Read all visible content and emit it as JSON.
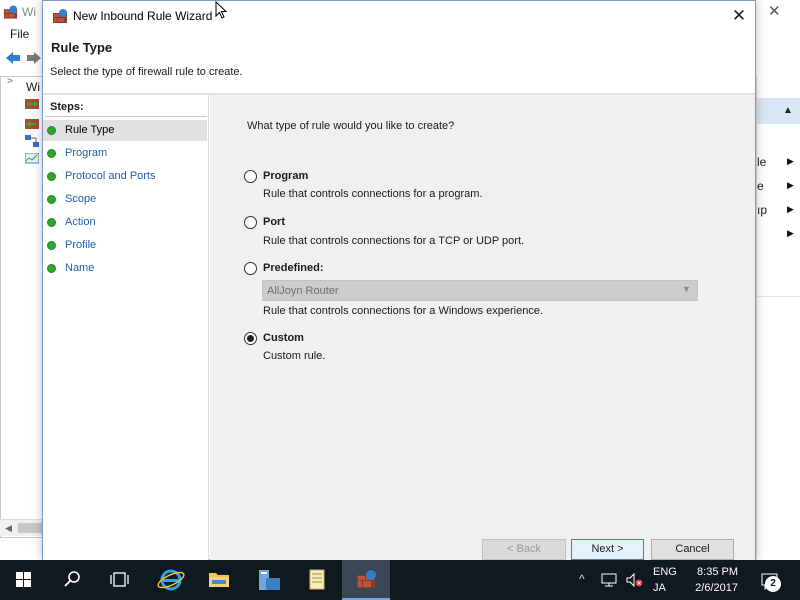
{
  "background_window": {
    "title": "Wi",
    "menu": {
      "file": "File"
    },
    "tree_root_label": "Wi",
    "actions_rows": [
      {
        "text": "le"
      },
      {
        "text": "e"
      },
      {
        "text": "ıp"
      },
      {
        "text": ""
      }
    ]
  },
  "wizard": {
    "title": "New Inbound Rule Wizard",
    "heading": "Rule Type",
    "subheading": "Select the type of firewall rule to create.",
    "steps_title": "Steps:",
    "steps": [
      {
        "label": "Rule Type",
        "current": true
      },
      {
        "label": "Program"
      },
      {
        "label": "Protocol and Ports"
      },
      {
        "label": "Scope"
      },
      {
        "label": "Action"
      },
      {
        "label": "Profile"
      },
      {
        "label": "Name"
      }
    ],
    "question": "What type of rule would you like to create?",
    "options": [
      {
        "title": "Program",
        "description": "Rule that controls connections for a program.",
        "selected": false
      },
      {
        "title": "Port",
        "description": "Rule that controls connections for a TCP or UDP port.",
        "selected": false
      },
      {
        "title": "Predefined:",
        "description": "Rule that controls connections for a Windows experience.",
        "selected": false,
        "dropdown_value": "AllJoyn Router",
        "dropdown_disabled": true
      },
      {
        "title": "Custom",
        "description": "Custom rule.",
        "selected": true
      }
    ],
    "buttons": {
      "back": "< Back",
      "next": "Next >",
      "cancel": "Cancel"
    }
  },
  "taskbar": {
    "language_line1": "ENG",
    "language_line2": "JA",
    "clock_time": "8:35 PM",
    "clock_date": "2/6/2017",
    "notification_count": "2"
  },
  "colors": {
    "accent_blue": "#1f5fa9",
    "step_done_green": "#2fa52f",
    "taskbar_bg": "#101820"
  }
}
